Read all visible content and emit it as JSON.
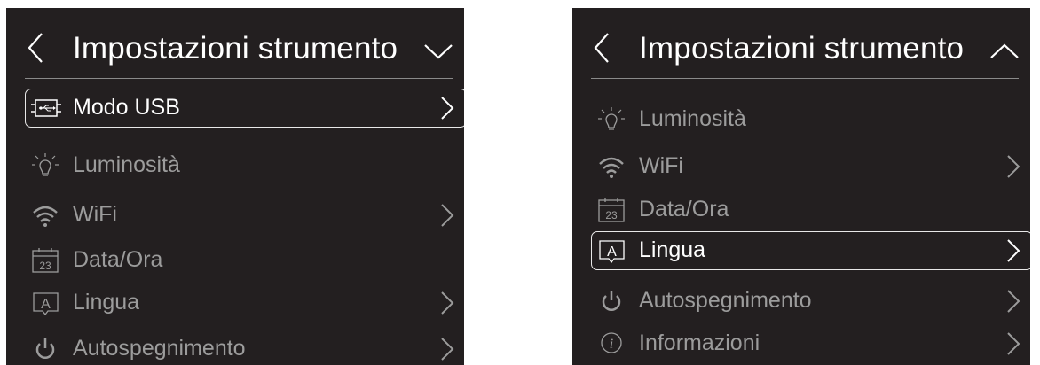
{
  "colors": {
    "background": "#231f20",
    "text": "#ffffff",
    "dimmed": "#9c9c9c",
    "highlight_border": "#e8e8e8"
  },
  "screens": [
    {
      "title": "Impostazioni strumento",
      "header_icon": "chevron-down-icon",
      "items": [
        {
          "label": "Modo USB",
          "icon": "usb-mode-icon",
          "has_arrow": true,
          "selected": true
        },
        {
          "label": "Luminosità",
          "icon": "lightbulb-icon",
          "has_arrow": false,
          "selected": false
        },
        {
          "label": "WiFi",
          "icon": "wifi-icon",
          "has_arrow": true,
          "selected": false
        },
        {
          "label": "Data/Ora",
          "icon": "calendar-icon",
          "icon_text": "23",
          "has_arrow": false,
          "selected": false
        },
        {
          "label": "Lingua",
          "icon": "language-icon",
          "icon_text": "A",
          "has_arrow": true,
          "selected": false
        },
        {
          "label": "Autospegnimento",
          "icon": "power-icon",
          "has_arrow": true,
          "selected": false
        }
      ]
    },
    {
      "title": "Impostazioni strumento",
      "header_icon": "chevron-up-icon",
      "items": [
        {
          "label": "Luminosità",
          "icon": "lightbulb-icon",
          "has_arrow": false,
          "selected": false
        },
        {
          "label": "WiFi",
          "icon": "wifi-icon",
          "has_arrow": true,
          "selected": false
        },
        {
          "label": "Data/Ora",
          "icon": "calendar-icon",
          "icon_text": "23",
          "has_arrow": false,
          "selected": false
        },
        {
          "label": "Lingua",
          "icon": "language-icon",
          "icon_text": "A",
          "has_arrow": true,
          "selected": true
        },
        {
          "label": "Autospegnimento",
          "icon": "power-icon",
          "has_arrow": true,
          "selected": false
        },
        {
          "label": "Informazioni",
          "icon": "info-icon",
          "icon_text": "i",
          "has_arrow": true,
          "selected": false
        }
      ]
    }
  ]
}
